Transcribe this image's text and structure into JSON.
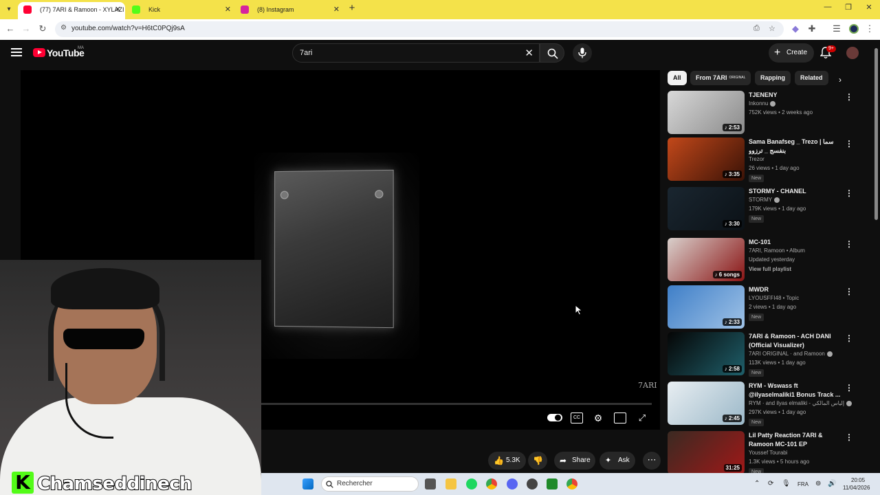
{
  "browser": {
    "tabs": [
      {
        "title": "(77) 7ARI & Ramoon - XYLAZI",
        "favicon_color": "#ff0033"
      },
      {
        "title": "Kick",
        "favicon_color": "#53fc18"
      },
      {
        "title": "(8) Instagram",
        "favicon_color": "#d6249f"
      }
    ],
    "url": "youtube.com/watch?v=H6tC0PQj9sA"
  },
  "youtube": {
    "logo_text": "YouTube",
    "region": "MA",
    "search_value": "7ari",
    "create_label": "Create",
    "notifications_badge": "9+"
  },
  "player": {
    "watermark": "7ARI"
  },
  "actions": {
    "like_count": "5.3K",
    "share_label": "Share",
    "ask_label": "Ask"
  },
  "streamer": {
    "name": "Chamseddinech",
    "badge_letter": "K"
  },
  "chips": [
    {
      "label": "All",
      "active": true
    },
    {
      "label": "From 7ARI",
      "sup": "ORIGINAL"
    },
    {
      "label": "Rapping"
    },
    {
      "label": "Related"
    }
  ],
  "recommendations": [
    {
      "title": "TJENENY",
      "channel": "Inkonnu",
      "verified": true,
      "meta": "752K views • 2 weeks ago",
      "badge": "♪ 2:53",
      "new": false,
      "thumb_colors": [
        "#d8d8d8",
        "#8a8a8a"
      ]
    },
    {
      "title": "Sama Banafseg _ Trezo | سما بنفسج _ ترزوو",
      "channel": "Trezor",
      "verified": false,
      "meta": "26 views • 1 day ago",
      "badge": "♪ 3:35",
      "new": true,
      "new_label": "New",
      "thumb_colors": [
        "#c2481a",
        "#3a1206"
      ]
    },
    {
      "title": "STORMY - CHANEL",
      "channel": "STORMY",
      "verified": true,
      "meta": "179K views • 1 day ago",
      "badge": "♪ 3:30",
      "new": true,
      "new_label": "New",
      "thumb_colors": [
        "#1a2630",
        "#0b1116"
      ]
    },
    {
      "title": "MC-101",
      "channel": "7ARI, Ramoon • Album",
      "verified": false,
      "meta": "Updated yesterday",
      "extra": "View full playlist",
      "badge": "♪ 6 songs",
      "new": false,
      "thumb_colors": [
        "#d9d0cc",
        "#8a1414"
      ]
    },
    {
      "title": "MWDR",
      "channel": "LYOUSFFI48 • Topic",
      "verified": false,
      "meta": "2 views • 1 day ago",
      "badge": "♪ 2:33",
      "new": true,
      "new_label": "New",
      "thumb_colors": [
        "#3f7fc8",
        "#9fc2e6"
      ]
    },
    {
      "title": "7ARI & Ramoon - ACH DANI (Official Visualizer)",
      "channel": "7ARI ORIGINAL · and Ramoon",
      "verified": true,
      "meta": "113K views • 1 day ago",
      "badge": "♪ 2:58",
      "new": true,
      "new_label": "New",
      "thumb_colors": [
        "#050505",
        "#1f5f6a"
      ]
    },
    {
      "title": "RYM - Wswass ft @ilyaselmaliki1 Bonus Track ...",
      "channel": "RYM · and ilyas elmaliki - إلياس المالكي",
      "verified": true,
      "meta": "297K views • 1 day ago",
      "badge": "♪ 2:45",
      "new": true,
      "new_label": "New",
      "thumb_colors": [
        "#e8eef2",
        "#9bb8c8"
      ]
    },
    {
      "title": "Lil Patty Reaction 7ARI & Ramoon MC-101 EP",
      "channel": "Youssef Tourabi",
      "verified": false,
      "meta": "1.3K views • 5 hours ago",
      "badge": "31:25",
      "new": true,
      "new_label": "New",
      "thumb_colors": [
        "#3a2a22",
        "#a01818"
      ]
    }
  ],
  "taskbar": {
    "search_placeholder": "Rechercher",
    "language": "FRA",
    "time": "20:05",
    "date": "11/04/2026"
  }
}
